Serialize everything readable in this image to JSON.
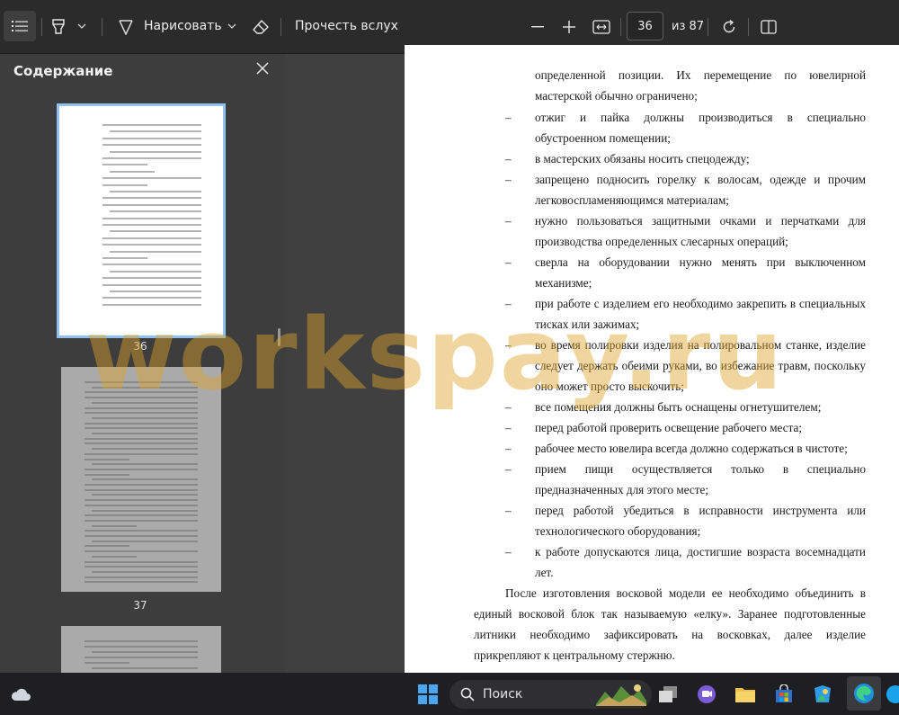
{
  "toolbar": {
    "draw_label": "Нарисовать",
    "read_aloud_label": "Прочесть вслух",
    "current_page": "36",
    "total_pages": "из 87"
  },
  "sidebar": {
    "title": "Содержание",
    "thumbnails": [
      {
        "page_number": "36"
      },
      {
        "page_number": "37"
      }
    ]
  },
  "document": {
    "lines": [
      "определенной позиции. Их перемещение по ювелирной",
      "мастерской обычно ограничено;",
      "отжиг и пайка должны производиться в специально",
      "обустроенном помещении;",
      "в мастерских обязаны носить спецодежду;",
      "запрещено подносить горелку к волосам, одежде и прочим",
      "легковоспламеняющимся материалам;",
      "нужно пользоваться защитными очками и перчатками для",
      "производства определенных слесарных операций;",
      "сверла на оборудовании нужно менять при выключенном",
      "механизме;",
      "при работе с изделием его необходимо закрепить в специальных",
      "тисках или зажимах;",
      "во время полировки изделия на полировальном станке, изделие",
      "следует держать обеими руками, во избежание травм, поскольку",
      "оно может просто выскочить;",
      "все помещения должны быть оснащены огнетушителем;",
      "перед работой проверить освещение рабочего места;",
      "рабочее место ювелира всегда должно содержаться в чистоте;",
      "прием пищи осуществляется только в специально",
      "предназначенных для этого месте;",
      "перед работой убедиться в исправности инструмента или",
      "технологического оборудования;",
      "к работе допускаются лица, достигшие возраста восемнадцати",
      "лет.",
      "После изготовления восковой модели ее необходимо объединить в",
      "единый восковой блок так называемую «елку». Заранее подготовленные",
      "литники необходимо зафиксировать на восковках, далее изделие",
      "прикрепляют к центральному стержню."
    ],
    "dash": "–"
  },
  "watermark": "workspay.ru",
  "taskbar": {
    "search_label": "Поиск"
  },
  "colors": {
    "toolbar_bg": "#2b2b2b",
    "sidebar_bg": "#3d3d3d",
    "selection_outline": "#8fc2f2",
    "watermark": "#dea528"
  }
}
